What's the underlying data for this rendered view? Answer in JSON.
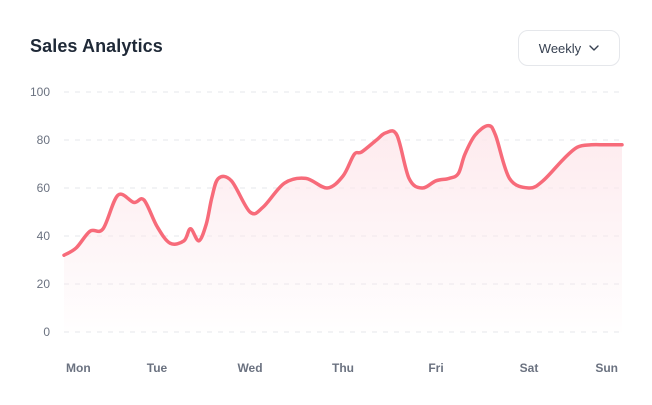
{
  "title": "Sales Analytics",
  "range_select": {
    "selected": "Weekly"
  },
  "colors": {
    "line": "#f76b7a",
    "fill_top": "#fde8ec",
    "grid": "#e5e7eb"
  },
  "chart_data": {
    "type": "area",
    "title": "Sales Analytics",
    "xlabel": "",
    "ylabel": "",
    "ylim": [
      0,
      100
    ],
    "yticks": [
      0,
      20,
      40,
      60,
      80,
      100
    ],
    "categories": [
      "Mon",
      "Tue",
      "Wed",
      "Thu",
      "Fri",
      "Sat",
      "Sun"
    ],
    "grid": true,
    "series": [
      {
        "x": [
          0,
          0.13,
          0.28,
          0.42,
          0.58,
          0.75,
          0.86,
          1.0,
          1.14,
          1.29,
          1.36,
          1.45,
          1.53,
          1.59,
          1.66,
          1.8,
          2.0,
          2.14,
          2.37,
          2.6,
          2.83,
          3.0,
          3.12,
          3.2,
          3.36,
          3.46,
          3.58,
          3.71,
          3.85,
          4.0,
          4.14,
          4.24,
          4.31,
          4.42,
          4.56,
          4.64,
          4.79,
          5.0,
          5.15,
          5.37,
          5.52,
          5.67,
          5.82,
          6.0
        ],
        "values": [
          32,
          35,
          42,
          43,
          57,
          54,
          55,
          44,
          37,
          38,
          43,
          38,
          45,
          56,
          64,
          63,
          50,
          52,
          62,
          64,
          60,
          65,
          74,
          75,
          80,
          83,
          82,
          64,
          60,
          63,
          64,
          66,
          74,
          82,
          86,
          82,
          64,
          60,
          63,
          72,
          77,
          78,
          78,
          78
        ]
      }
    ]
  }
}
